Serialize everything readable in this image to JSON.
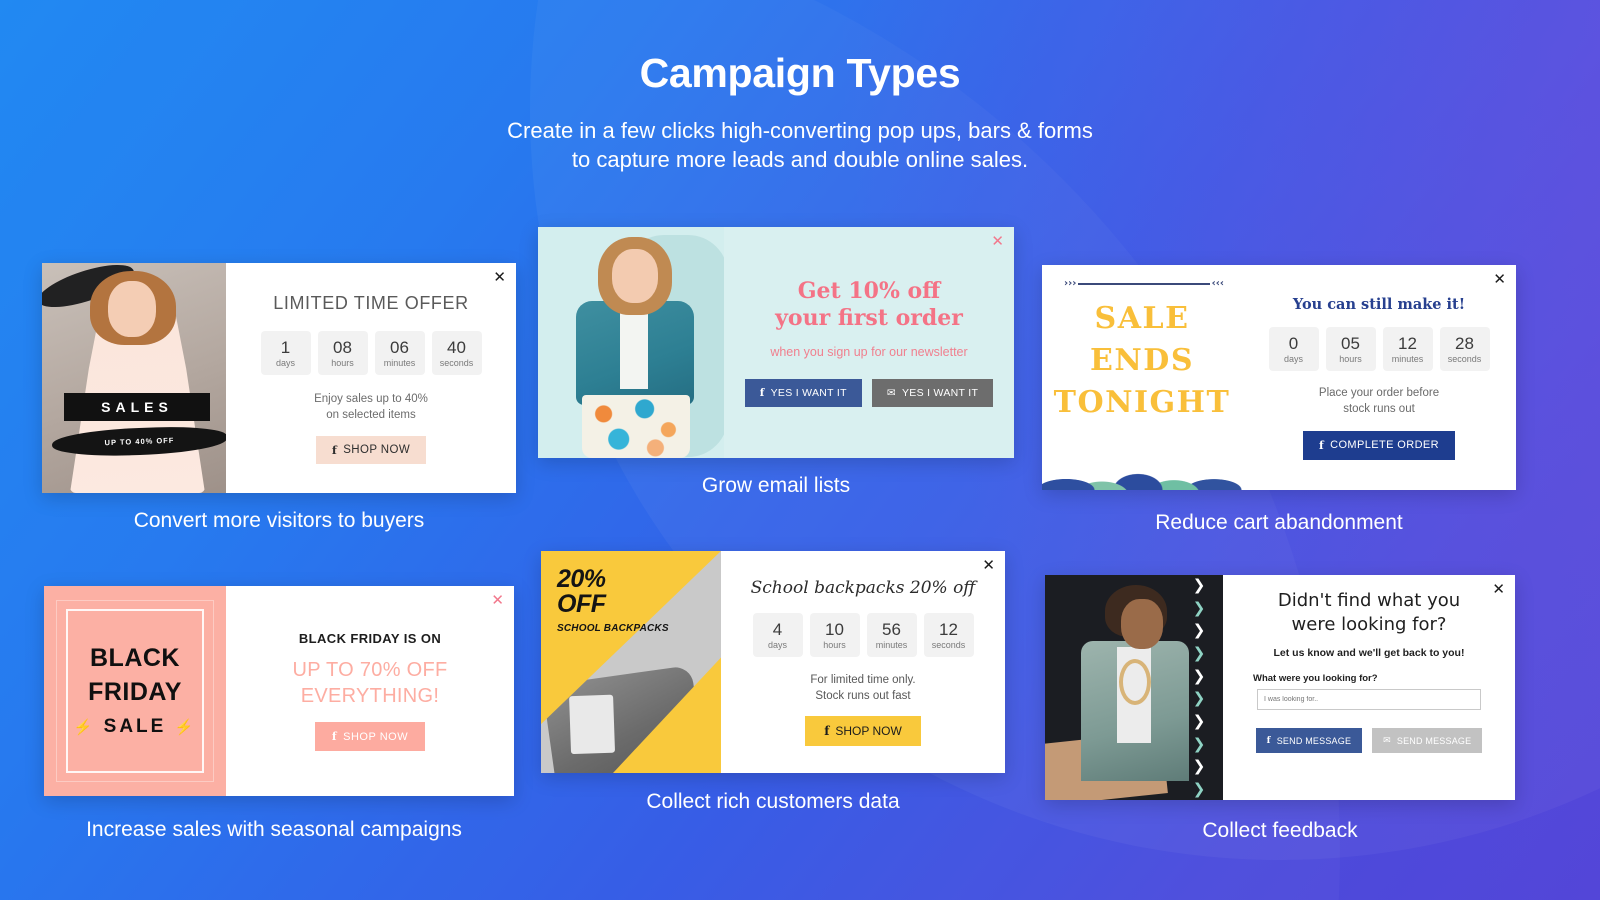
{
  "header": {
    "title": "Campaign Types",
    "subtitle_line1": "Create in a few clicks high-converting pop ups, bars & forms",
    "subtitle_line2": "to capture more leads and double online sales."
  },
  "colors": {
    "bg_start": "#1a86f2",
    "bg_end": "#5346d8",
    "accent_pink": "#f47386",
    "accent_yellow": "#f9c93c",
    "facebook_blue": "#3b5998",
    "navy": "#1e3d8f"
  },
  "cards": [
    {
      "id": "card1",
      "name": "limited-time-offer",
      "close_icon": "close-icon",
      "title": "LIMITED TIME OFFER",
      "countdown": [
        {
          "value": "1",
          "label": "days"
        },
        {
          "value": "08",
          "label": "hours"
        },
        {
          "value": "06",
          "label": "minutes"
        },
        {
          "value": "40",
          "label": "seconds"
        }
      ],
      "blurb_line1": "Enjoy sales up to 40%",
      "blurb_line2": "on selected items",
      "cta": "SHOP NOW",
      "cta_icon": "facebook-icon",
      "media": {
        "badge": "SALES",
        "sub_badge": "UP TO 40% OFF"
      },
      "caption": "Convert more visitors to buyers"
    },
    {
      "id": "card2",
      "name": "grow-email-lists",
      "close_icon": "close-icon",
      "headline_line1": "Get 10% off",
      "headline_line2": "your first order",
      "subline": "when you sign up for our newsletter",
      "buttons": [
        {
          "label": "YES I WANT IT",
          "icon": "facebook-icon",
          "style": "facebook"
        },
        {
          "label": "YES I WANT IT",
          "icon": "envelope-icon",
          "style": "grey"
        }
      ],
      "caption": "Grow email lists"
    },
    {
      "id": "card3",
      "name": "reduce-cart-abandonment",
      "close_icon": "close-icon",
      "title": "You can still make it!",
      "countdown": [
        {
          "value": "0",
          "label": "days"
        },
        {
          "value": "05",
          "label": "hours"
        },
        {
          "value": "12",
          "label": "minutes"
        },
        {
          "value": "28",
          "label": "seconds"
        }
      ],
      "blurb_line1": "Place your order before",
      "blurb_line2": "stock runs out",
      "cta": "COMPLETE ORDER",
      "cta_icon": "facebook-icon",
      "media": {
        "word1": "SALE",
        "word2": "ENDS",
        "word3": "TONIGHT"
      },
      "caption": "Reduce cart abandonment"
    },
    {
      "id": "card4",
      "name": "black-friday-seasonal",
      "close_icon": "close-icon",
      "title": "BLACK FRIDAY IS ON",
      "subtitle_line1": "UP TO 70% OFF",
      "subtitle_line2": "EVERYTHING!",
      "cta": "SHOP NOW",
      "cta_icon": "facebook-icon",
      "media": {
        "word1": "BLACK",
        "word2": "FRIDAY",
        "word3": "SALE",
        "bolt": "⚡"
      },
      "caption": "Increase sales with seasonal campaigns"
    },
    {
      "id": "card5",
      "name": "school-backpacks",
      "close_icon": "close-icon",
      "title": "School backpacks 20% off",
      "countdown": [
        {
          "value": "4",
          "label": "days"
        },
        {
          "value": "10",
          "label": "hours"
        },
        {
          "value": "56",
          "label": "minutes"
        },
        {
          "value": "12",
          "label": "seconds"
        }
      ],
      "blurb_line1": "For limited time only.",
      "blurb_line2": "Stock runs out fast",
      "cta": "SHOP NOW",
      "cta_icon": "facebook-icon",
      "media": {
        "percent": "20%",
        "off": "OFF",
        "sub": "SCHOOL BACKPACKS"
      },
      "caption": "Collect rich customers data"
    },
    {
      "id": "card6",
      "name": "collect-feedback",
      "close_icon": "close-icon",
      "title_line1": "Didn't find what you",
      "title_line2": "were looking for?",
      "subtitle": "Let us know and we'll get back to you!",
      "field_label": "What were you looking for?",
      "field_placeholder": "I was looking for..",
      "buttons": [
        {
          "label": "SEND MESSAGE",
          "icon": "facebook-icon",
          "style": "facebook"
        },
        {
          "label": "SEND MESSAGE",
          "icon": "envelope-icon",
          "style": "grey"
        }
      ],
      "caption": "Collect feedback"
    }
  ]
}
